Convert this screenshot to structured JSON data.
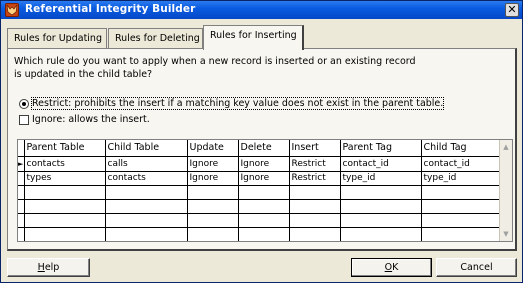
{
  "window": {
    "title": "Referential Integrity Builder",
    "close_glyph": "✕"
  },
  "tabs": [
    {
      "label": "Rules for Updating",
      "active": false
    },
    {
      "label": "Rules for Deleting",
      "active": false
    },
    {
      "label": "Rules for Inserting",
      "active": true
    }
  ],
  "question": "Which rule do you want to apply when a new record is inserted or an existing record is updated in the child table?",
  "options": [
    {
      "label": "Restrict: prohibits the insert if a matching key value does not exist in the parent table.",
      "checked": true,
      "control": "radio"
    },
    {
      "label": "Ignore: allows the insert.",
      "checked": false,
      "control": "checkbox"
    }
  ],
  "grid": {
    "columns": [
      "Parent Table",
      "Child Table",
      "Update",
      "Delete",
      "Insert",
      "Parent Tag",
      "Child Tag"
    ],
    "rows": [
      [
        "contacts",
        "calls",
        "Ignore",
        "Ignore",
        "Restrict",
        "contact_id",
        "contact_id"
      ],
      [
        "types",
        "contacts",
        "Ignore",
        "Ignore",
        "Restrict",
        "type_id",
        "type_id"
      ]
    ],
    "empty_rows": 5,
    "current_row_marker": "►",
    "scroll_up_glyph": "▲",
    "scroll_down_glyph": "▼"
  },
  "buttons": {
    "help": {
      "pre": "",
      "accel": "H",
      "post": "elp"
    },
    "ok": {
      "pre": "",
      "accel": "O",
      "post": "K"
    },
    "cancel": {
      "label": "Cancel"
    }
  },
  "colors": {
    "titlebar": "#0a5be0",
    "dialog_bg": "#ece9d8",
    "panel_bg": "#f7f6f0"
  },
  "icons": {
    "title": "fox-app-icon",
    "close": "close-icon"
  }
}
